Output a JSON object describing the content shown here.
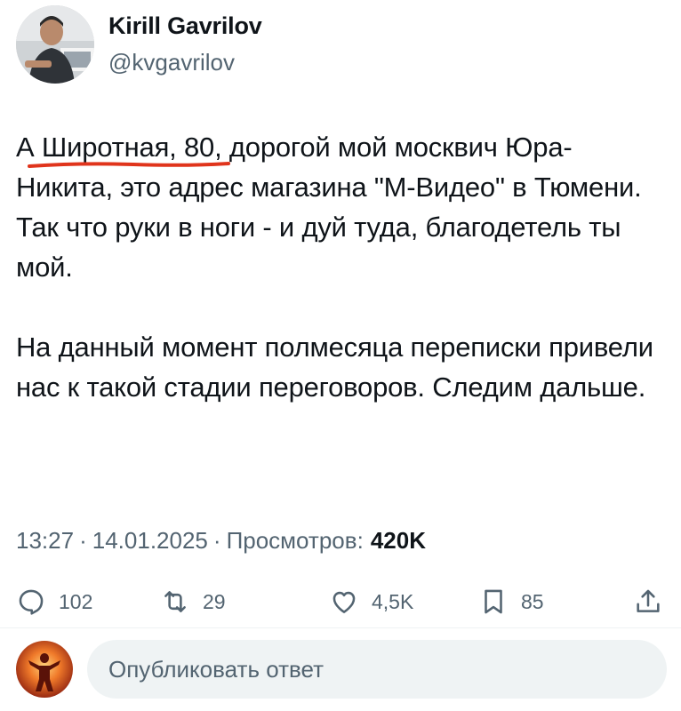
{
  "author": {
    "name": "Kirill Gavrilov",
    "handle": "@kvgavrilov"
  },
  "tweet": {
    "line_1_prefix": "А ",
    "line_1_highlight": "Широтная, 80",
    "line_1_rest": ", дорогой мой москвич Юра-Никита, это адрес магазина \"М-Видео\" в Тюмени.",
    "line_2": "Так что руки в ноги - и дуй туда, благодетель ты мой.",
    "line_3": "На данный момент полмесяца переписки привели нас к такой стадии переговоров. Следим дальше.",
    "highlight_color": "#e0341c"
  },
  "meta": {
    "time": "13:27",
    "date": "14.01.2025",
    "views_label": "Просмотров:",
    "views_count": "420K"
  },
  "actions": {
    "replies": "102",
    "reposts": "29",
    "likes": "4,5K",
    "bookmarks": "85"
  },
  "reply_box": {
    "placeholder": "Опубликовать ответ"
  },
  "colors": {
    "text": "#0f1419",
    "secondary": "#536471",
    "input_bg": "#eff3f4"
  }
}
